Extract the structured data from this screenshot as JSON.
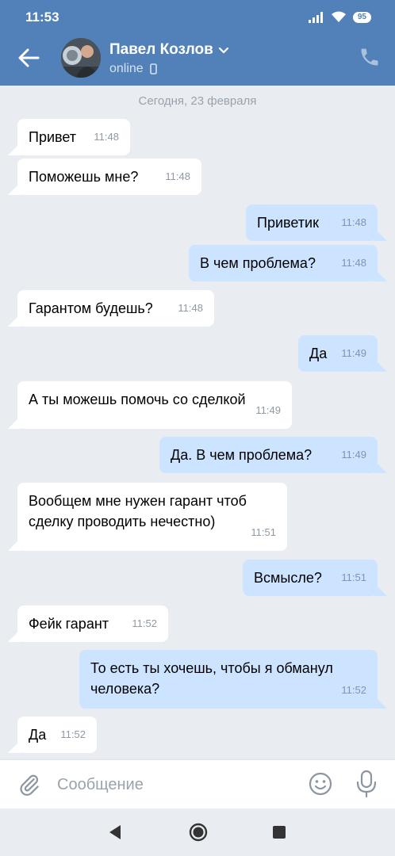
{
  "status_bar": {
    "time": "11:53",
    "battery": "95"
  },
  "header": {
    "contact_name": "Павел Козлов",
    "contact_status": "online"
  },
  "chat": {
    "date_separator": "Сегодня, 23 февраля",
    "messages": [
      {
        "direction": "in",
        "text": "Привет",
        "time": "11:48"
      },
      {
        "direction": "in",
        "text": "Поможешь мне?",
        "time": "11:48"
      },
      {
        "direction": "out",
        "text": "Приветик",
        "time": "11:48"
      },
      {
        "direction": "out",
        "text": "В чем проблема?",
        "time": "11:48"
      },
      {
        "direction": "in",
        "text": "Гарантом будешь?",
        "time": "11:48"
      },
      {
        "direction": "out",
        "text": "Да",
        "time": "11:49"
      },
      {
        "direction": "in",
        "text": "А ты можешь помочь со сделкой",
        "time": "11:49"
      },
      {
        "direction": "out",
        "text": "Да. В чем проблема?",
        "time": "11:49"
      },
      {
        "direction": "in",
        "text": "Вообщем мне нужен гарант чтоб сделку проводить нечестно)",
        "time": "11:51"
      },
      {
        "direction": "out",
        "text": "Всмысле?",
        "time": "11:51"
      },
      {
        "direction": "in",
        "text": "Фейк гарант",
        "time": "11:52"
      },
      {
        "direction": "out",
        "text": "То есть ты хочешь, чтобы я обманул человека?",
        "time": "11:52"
      },
      {
        "direction": "in",
        "text": "Да",
        "time": "11:52"
      }
    ]
  },
  "composer": {
    "placeholder": "Сообщение",
    "value": ""
  },
  "icons": {
    "back": "arrow-left-icon",
    "call": "phone-icon",
    "attach": "paperclip-icon",
    "emoji": "smiley-icon",
    "mic": "microphone-icon"
  },
  "colors": {
    "header": "#5181b8",
    "chat_bg": "#e9edf1",
    "incoming_bubble": "#ffffff",
    "outgoing_bubble": "#cce4ff"
  }
}
